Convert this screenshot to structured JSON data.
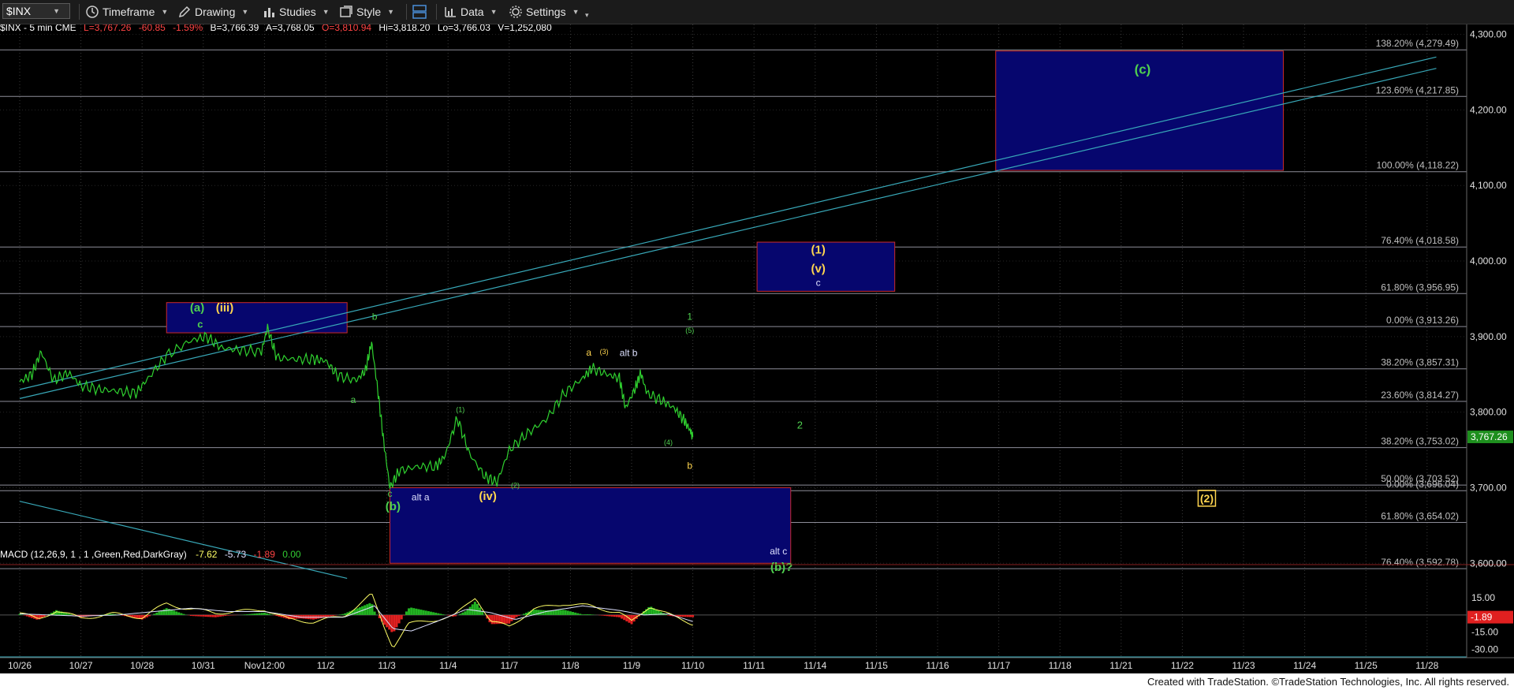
{
  "toolbar": {
    "symbol": "$INX",
    "timeframe": "Timeframe",
    "drawing": "Drawing",
    "studies": "Studies",
    "style": "Style",
    "data": "Data",
    "settings": "Settings"
  },
  "header": {
    "symbol": "$INX - 5 min  CME",
    "last": "L=3,767.26",
    "change": "-60.85",
    "pct": "-1.59%",
    "bid": "B=3,766.39",
    "ask": "A=3,768.05",
    "open": "O=3,810.94",
    "high": "Hi=3,818.20",
    "low": "Lo=3,766.03",
    "volume": "V=1,252,080"
  },
  "macd": {
    "label": "MACD (12,26,9, 1 , 1 ,Green,Red,DarkGray)",
    "v1": "-7.62",
    "v2": "-5.73",
    "v3": "-1.89",
    "v4": "0.00",
    "current": "-1.89",
    "ticks": [
      "15.00",
      "-15.00",
      "-30.00"
    ]
  },
  "chart_data": {
    "type": "line",
    "x_labels": [
      "10/26",
      "10/27",
      "10/28",
      "10/31",
      "Nov12:00",
      "11/2",
      "11/3",
      "11/4",
      "11/7",
      "11/8",
      "11/9",
      "11/10",
      "11/11",
      "11/14",
      "11/15",
      "11/16",
      "11/17",
      "11/18",
      "11/21",
      "11/22",
      "11/23",
      "11/24",
      "11/25",
      "11/28"
    ],
    "y_ticks": [
      "4,300.00",
      "4,200.00",
      "4,100.00",
      "4,000.00",
      "3,900.00",
      "3,800.00",
      "3,700.00",
      "3,600.00"
    ],
    "ylim": [
      3570,
      4310
    ],
    "last_price": "3,767.26",
    "price_path": [
      [
        0,
        3840
      ],
      [
        0.2,
        3850
      ],
      [
        0.35,
        3880
      ],
      [
        0.55,
        3842
      ],
      [
        0.8,
        3852
      ],
      [
        1.0,
        3835
      ],
      [
        1.3,
        3830
      ],
      [
        1.6,
        3828
      ],
      [
        1.9,
        3825
      ],
      [
        2.1,
        3845
      ],
      [
        2.4,
        3875
      ],
      [
        2.8,
        3895
      ],
      [
        3.05,
        3900
      ],
      [
        3.3,
        3885
      ],
      [
        3.6,
        3882
      ],
      [
        3.95,
        3880
      ],
      [
        4.05,
        3912
      ],
      [
        4.2,
        3872
      ],
      [
        4.5,
        3870
      ],
      [
        4.8,
        3870
      ],
      [
        5.0,
        3868
      ],
      [
        5.2,
        3848
      ],
      [
        5.5,
        3842
      ],
      [
        5.65,
        3855
      ],
      [
        5.75,
        3892
      ],
      [
        5.85,
        3830
      ],
      [
        5.95,
        3760
      ],
      [
        6.05,
        3700
      ],
      [
        6.2,
        3722
      ],
      [
        6.5,
        3728
      ],
      [
        6.8,
        3728
      ],
      [
        6.95,
        3742
      ],
      [
        7.15,
        3792
      ],
      [
        7.35,
        3745
      ],
      [
        7.6,
        3715
      ],
      [
        7.8,
        3707
      ],
      [
        8.0,
        3750
      ],
      [
        8.3,
        3772
      ],
      [
        8.6,
        3790
      ],
      [
        8.9,
        3825
      ],
      [
        9.2,
        3845
      ],
      [
        9.35,
        3858
      ],
      [
        9.6,
        3850
      ],
      [
        9.8,
        3845
      ],
      [
        9.9,
        3805
      ],
      [
        10.05,
        3830
      ],
      [
        10.15,
        3852
      ],
      [
        10.25,
        3825
      ],
      [
        10.5,
        3815
      ],
      [
        10.7,
        3805
      ],
      [
        10.85,
        3790
      ],
      [
        10.95,
        3777
      ],
      [
        11.0,
        3767
      ]
    ],
    "macd_path": [
      [
        0,
        2
      ],
      [
        0.3,
        -4
      ],
      [
        0.6,
        4
      ],
      [
        1.0,
        -3
      ],
      [
        1.5,
        1
      ],
      [
        2.0,
        -2
      ],
      [
        2.4,
        10
      ],
      [
        2.7,
        6
      ],
      [
        3.2,
        2
      ],
      [
        3.6,
        3
      ],
      [
        4.0,
        5
      ],
      [
        4.4,
        -4
      ],
      [
        4.8,
        -6
      ],
      [
        5.3,
        -1
      ],
      [
        5.75,
        18
      ],
      [
        5.95,
        -10
      ],
      [
        6.1,
        -28
      ],
      [
        6.35,
        -8
      ],
      [
        6.8,
        -4
      ],
      [
        7.1,
        -1
      ],
      [
        7.45,
        16
      ],
      [
        7.7,
        -6
      ],
      [
        8.0,
        -10
      ],
      [
        8.4,
        5
      ],
      [
        8.9,
        10
      ],
      [
        9.3,
        8
      ],
      [
        9.8,
        2
      ],
      [
        10.0,
        -6
      ],
      [
        10.3,
        8
      ],
      [
        10.7,
        -2
      ],
      [
        11.0,
        -7.6
      ]
    ],
    "signal_path": [
      [
        0,
        1
      ],
      [
        0.5,
        0
      ],
      [
        1.0,
        -1
      ],
      [
        1.6,
        0
      ],
      [
        2.2,
        3
      ],
      [
        2.8,
        6
      ],
      [
        3.4,
        3
      ],
      [
        4.0,
        3
      ],
      [
        4.6,
        -2
      ],
      [
        5.3,
        -2
      ],
      [
        5.8,
        8
      ],
      [
        6.1,
        -12
      ],
      [
        6.4,
        -14
      ],
      [
        6.8,
        -6
      ],
      [
        7.3,
        5
      ],
      [
        7.7,
        2
      ],
      [
        8.1,
        -4
      ],
      [
        8.6,
        3
      ],
      [
        9.2,
        8
      ],
      [
        9.8,
        4
      ],
      [
        10.2,
        0
      ],
      [
        10.6,
        1
      ],
      [
        11.0,
        -5.7
      ]
    ],
    "fib_levels": [
      {
        "label": "138.20% (4,279.49)",
        "value": 4279.49
      },
      {
        "label": "123.60% (4,217.85)",
        "value": 4217.85
      },
      {
        "label": "100.00% (4,118.22)",
        "value": 4118.22
      },
      {
        "label": "76.40% (4,018.58)",
        "value": 4018.58
      },
      {
        "label": "61.80% (3,956.95)",
        "value": 3956.95
      },
      {
        "label": "0.00% (3,913.26)",
        "value": 3913.26
      },
      {
        "label": "38.20% (3,857.31)",
        "value": 3857.31
      },
      {
        "label": "23.60% (3,814.27)",
        "value": 3814.27
      },
      {
        "label": "38.20% (3,753.02)",
        "value": 3753.02
      },
      {
        "label": "50.00% (3,703.52)",
        "value": 3703.52
      },
      {
        "label": "0.00% (3,696.04)",
        "value": 3696.04
      },
      {
        "label": "61.80% (3,654.02)",
        "value": 3654.02
      },
      {
        "label": "76.40% (3,592.78)",
        "value": 3592.78
      }
    ],
    "boxes": [
      {
        "x0": 2.4,
        "x1": 5.35,
        "y0": 3905,
        "y1": 3945
      },
      {
        "x0": 6.05,
        "x1": 12.6,
        "y0": 3600,
        "y1": 3700
      },
      {
        "x0": 12.05,
        "x1": 14.3,
        "y0": 3960,
        "y1": 4025
      },
      {
        "x0": 15.95,
        "x1": 20.65,
        "y0": 4120,
        "y1": 4278
      }
    ],
    "wave_labels": [
      {
        "text": "(a)",
        "x": 2.9,
        "y": 3933,
        "color": "#4fd04f",
        "size": 15,
        "bold": true
      },
      {
        "text": "(iii)",
        "x": 3.35,
        "y": 3933,
        "color": "#ffd54f",
        "size": 15,
        "bold": true
      },
      {
        "text": "c",
        "x": 2.95,
        "y": 3912,
        "color": "#4fd04f",
        "size": 13,
        "bold": true
      },
      {
        "text": "b",
        "x": 5.8,
        "y": 3922,
        "color": "#4fd04f",
        "size": 12,
        "bold": false
      },
      {
        "text": "a",
        "x": 5.45,
        "y": 3812,
        "color": "#4fd04f",
        "size": 12,
        "bold": false
      },
      {
        "text": "c",
        "x": 6.05,
        "y": 3688,
        "color": "#4fd04f",
        "size": 12,
        "bold": false
      },
      {
        "text": "(b)",
        "x": 6.1,
        "y": 3670,
        "color": "#4fd04f",
        "size": 15,
        "bold": true
      },
      {
        "text": "alt a",
        "x": 6.55,
        "y": 3683,
        "color": "#dde0ff",
        "size": 12,
        "bold": false
      },
      {
        "text": "(iv)",
        "x": 7.65,
        "y": 3684,
        "color": "#ffd54f",
        "size": 15,
        "bold": true
      },
      {
        "text": "(1)",
        "x": 7.2,
        "y": 3800,
        "color": "#4fd04f",
        "size": 9,
        "bold": false
      },
      {
        "text": "(2)",
        "x": 8.1,
        "y": 3700,
        "color": "#4fd04f",
        "size": 9,
        "bold": false
      },
      {
        "text": "a",
        "x": 9.3,
        "y": 3875,
        "color": "#ffd54f",
        "size": 12,
        "bold": false
      },
      {
        "text": "(3)",
        "x": 9.55,
        "y": 3877,
        "color": "#ffd54f",
        "size": 9,
        "bold": false
      },
      {
        "text": "alt b",
        "x": 9.95,
        "y": 3874,
        "color": "#dde0ff",
        "size": 12,
        "bold": false
      },
      {
        "text": "(4)",
        "x": 10.6,
        "y": 3757,
        "color": "#4fd04f",
        "size": 9,
        "bold": false
      },
      {
        "text": "b",
        "x": 10.95,
        "y": 3725,
        "color": "#ffd54f",
        "size": 12,
        "bold": false
      },
      {
        "text": "1",
        "x": 10.95,
        "y": 3922,
        "color": "#4fd04f",
        "size": 12,
        "bold": false
      },
      {
        "text": "(5)",
        "x": 10.95,
        "y": 3905,
        "color": "#4fd04f",
        "size": 9,
        "bold": false
      },
      {
        "text": "2",
        "x": 12.75,
        "y": 3778,
        "color": "#4fd04f",
        "size": 13,
        "bold": false
      },
      {
        "text": "alt c",
        "x": 12.4,
        "y": 3612,
        "color": "#dde0ff",
        "size": 12,
        "bold": false
      },
      {
        "text": "(b)?",
        "x": 12.45,
        "y": 3590,
        "color": "#4fd04f",
        "size": 15,
        "bold": true
      },
      {
        "text": "(1)",
        "x": 13.05,
        "y": 4010,
        "color": "#ffd54f",
        "size": 15,
        "bold": true
      },
      {
        "text": "(v)",
        "x": 13.05,
        "y": 3985,
        "color": "#ffd54f",
        "size": 15,
        "bold": true
      },
      {
        "text": "c",
        "x": 13.05,
        "y": 3967,
        "color": "#dde0ff",
        "size": 12,
        "bold": false
      },
      {
        "text": "(c)",
        "x": 18.35,
        "y": 4248,
        "color": "#4fd04f",
        "size": 17,
        "bold": true
      }
    ],
    "boxed_label": {
      "text": "(2)",
      "x": 19.4,
      "y": 3686
    },
    "trendlines": [
      {
        "x0": 0,
        "y0": 3830,
        "x1": 23.15,
        "y1": 4270
      },
      {
        "x0": 0,
        "y0": 3818,
        "x1": 23.15,
        "y1": 4255
      },
      {
        "x0": 0,
        "y0": 3682,
        "x1": 5.35,
        "y1": 3580
      }
    ]
  },
  "footer": {
    "text": "Created with TradeStation. ©TradeStation Technologies, Inc. All rights reserved."
  }
}
